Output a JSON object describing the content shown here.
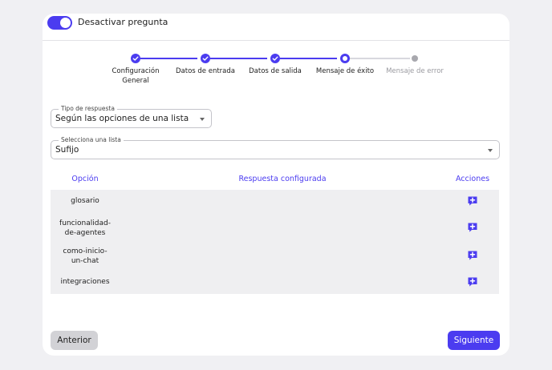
{
  "header": {
    "toggle_label": "Desactivar pregunta",
    "toggle_on": true
  },
  "stepper": {
    "steps": [
      {
        "label": "Configuración\nGeneral",
        "state": "done"
      },
      {
        "label": "Datos de entrada",
        "state": "done"
      },
      {
        "label": "Datos de salida",
        "state": "done"
      },
      {
        "label": "Mensaje de éxito",
        "state": "current"
      },
      {
        "label": "Mensaje de error",
        "state": "pending"
      }
    ]
  },
  "response_type": {
    "legend": "Tipo de respuesta",
    "value": "Según las opciones de una lista"
  },
  "list_select": {
    "legend": "Selecciona una lista",
    "value": "Sufijo"
  },
  "table": {
    "headers": {
      "option": "Opción",
      "response": "Respuesta configurada",
      "actions": "Acciones"
    },
    "rows": [
      {
        "option": "glosario",
        "response": ""
      },
      {
        "option": "funcionalidad-\nde-agentes",
        "response": ""
      },
      {
        "option": "como-inicio-\nun-chat",
        "response": ""
      },
      {
        "option": "integraciones",
        "response": ""
      }
    ],
    "action_icon": "add-comment-icon"
  },
  "footer": {
    "prev_label": "Anterior",
    "next_label": "Siguiente"
  },
  "colors": {
    "accent": "#4b3cf0",
    "inactive": "#d8d8de",
    "table_bg": "#efeff1"
  }
}
